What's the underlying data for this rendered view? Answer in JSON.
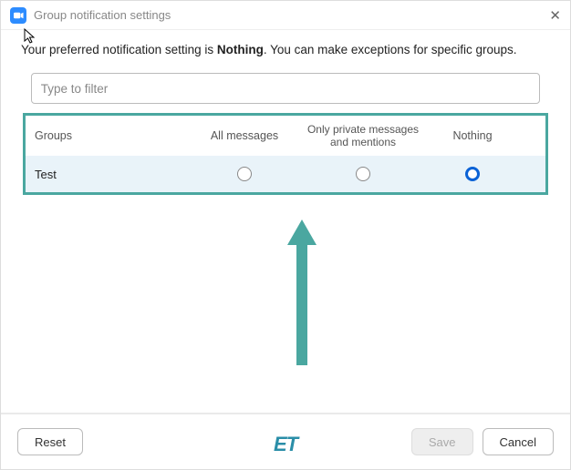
{
  "titlebar": {
    "title": "Group notification settings"
  },
  "intro": {
    "prefix": "Your preferred notification setting is ",
    "bold": "Nothing",
    "suffix": ". You can make exceptions for specific groups."
  },
  "filter": {
    "placeholder": "Type to filter"
  },
  "table": {
    "headers": {
      "groups": "Groups",
      "all": "All messages",
      "pm": "Only private messages and mentions",
      "nothing": "Nothing"
    },
    "rows": [
      {
        "name": "Test",
        "selected": "nothing"
      }
    ]
  },
  "footer": {
    "reset": "Reset",
    "save": "Save",
    "cancel": "Cancel"
  },
  "watermark": "ET"
}
